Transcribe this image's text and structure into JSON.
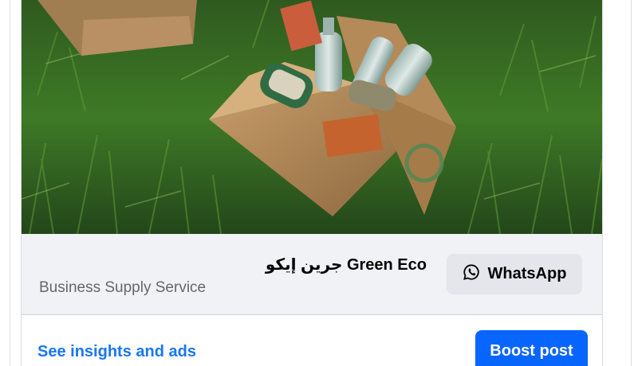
{
  "post": {
    "image_description_icon": "photo",
    "preview": {
      "page_name": "جرين إيكو Green Eco",
      "category": "Business Supply Service",
      "whatsapp_label": "WhatsApp",
      "whatsapp_icon": "whatsapp-icon"
    },
    "actions": {
      "insights_label": "See insights and ads",
      "boost_label": "Boost post"
    }
  },
  "colors": {
    "link_blue": "#1877f2",
    "boost_blue": "#0866ff",
    "preview_bg": "#f0f2f5",
    "button_gray": "#e4e6eb"
  }
}
